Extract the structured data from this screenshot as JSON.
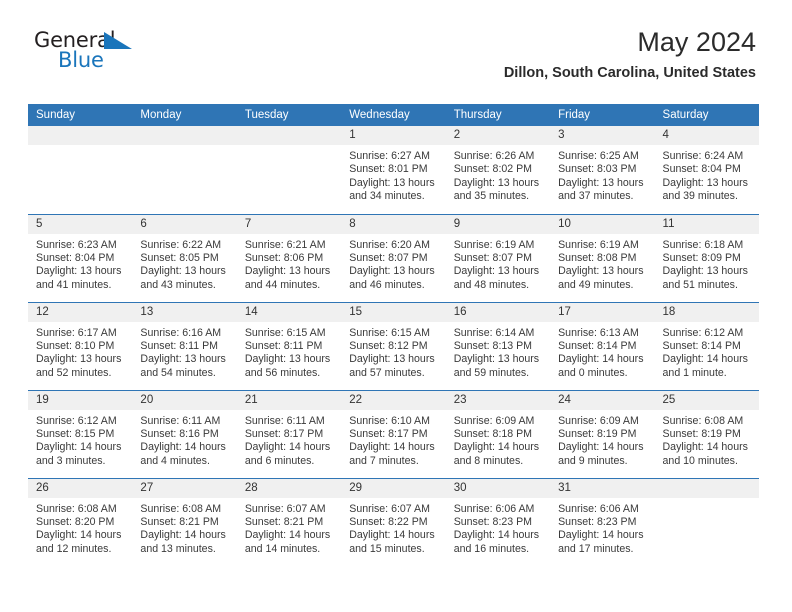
{
  "brand": {
    "name_part1": "General",
    "name_part2": "Blue"
  },
  "header": {
    "title": "May 2024",
    "subtitle": "Dillon, South Carolina, United States"
  },
  "colors": {
    "header_blue": "#2f75b5",
    "brand_blue": "#1a75bb",
    "daynum_bg": "#f0f0f0",
    "text": "#3a3a3a"
  },
  "weekday_headers": [
    "Sunday",
    "Monday",
    "Tuesday",
    "Wednesday",
    "Thursday",
    "Friday",
    "Saturday"
  ],
  "weeks": [
    [
      {
        "day": "",
        "sunrise": "",
        "sunset": "",
        "daylight_1": "",
        "daylight_2": ""
      },
      {
        "day": "",
        "sunrise": "",
        "sunset": "",
        "daylight_1": "",
        "daylight_2": ""
      },
      {
        "day": "",
        "sunrise": "",
        "sunset": "",
        "daylight_1": "",
        "daylight_2": ""
      },
      {
        "day": "1",
        "sunrise": "Sunrise: 6:27 AM",
        "sunset": "Sunset: 8:01 PM",
        "daylight_1": "Daylight: 13 hours",
        "daylight_2": "and 34 minutes."
      },
      {
        "day": "2",
        "sunrise": "Sunrise: 6:26 AM",
        "sunset": "Sunset: 8:02 PM",
        "daylight_1": "Daylight: 13 hours",
        "daylight_2": "and 35 minutes."
      },
      {
        "day": "3",
        "sunrise": "Sunrise: 6:25 AM",
        "sunset": "Sunset: 8:03 PM",
        "daylight_1": "Daylight: 13 hours",
        "daylight_2": "and 37 minutes."
      },
      {
        "day": "4",
        "sunrise": "Sunrise: 6:24 AM",
        "sunset": "Sunset: 8:04 PM",
        "daylight_1": "Daylight: 13 hours",
        "daylight_2": "and 39 minutes."
      }
    ],
    [
      {
        "day": "5",
        "sunrise": "Sunrise: 6:23 AM",
        "sunset": "Sunset: 8:04 PM",
        "daylight_1": "Daylight: 13 hours",
        "daylight_2": "and 41 minutes."
      },
      {
        "day": "6",
        "sunrise": "Sunrise: 6:22 AM",
        "sunset": "Sunset: 8:05 PM",
        "daylight_1": "Daylight: 13 hours",
        "daylight_2": "and 43 minutes."
      },
      {
        "day": "7",
        "sunrise": "Sunrise: 6:21 AM",
        "sunset": "Sunset: 8:06 PM",
        "daylight_1": "Daylight: 13 hours",
        "daylight_2": "and 44 minutes."
      },
      {
        "day": "8",
        "sunrise": "Sunrise: 6:20 AM",
        "sunset": "Sunset: 8:07 PM",
        "daylight_1": "Daylight: 13 hours",
        "daylight_2": "and 46 minutes."
      },
      {
        "day": "9",
        "sunrise": "Sunrise: 6:19 AM",
        "sunset": "Sunset: 8:07 PM",
        "daylight_1": "Daylight: 13 hours",
        "daylight_2": "and 48 minutes."
      },
      {
        "day": "10",
        "sunrise": "Sunrise: 6:19 AM",
        "sunset": "Sunset: 8:08 PM",
        "daylight_1": "Daylight: 13 hours",
        "daylight_2": "and 49 minutes."
      },
      {
        "day": "11",
        "sunrise": "Sunrise: 6:18 AM",
        "sunset": "Sunset: 8:09 PM",
        "daylight_1": "Daylight: 13 hours",
        "daylight_2": "and 51 minutes."
      }
    ],
    [
      {
        "day": "12",
        "sunrise": "Sunrise: 6:17 AM",
        "sunset": "Sunset: 8:10 PM",
        "daylight_1": "Daylight: 13 hours",
        "daylight_2": "and 52 minutes."
      },
      {
        "day": "13",
        "sunrise": "Sunrise: 6:16 AM",
        "sunset": "Sunset: 8:11 PM",
        "daylight_1": "Daylight: 13 hours",
        "daylight_2": "and 54 minutes."
      },
      {
        "day": "14",
        "sunrise": "Sunrise: 6:15 AM",
        "sunset": "Sunset: 8:11 PM",
        "daylight_1": "Daylight: 13 hours",
        "daylight_2": "and 56 minutes."
      },
      {
        "day": "15",
        "sunrise": "Sunrise: 6:15 AM",
        "sunset": "Sunset: 8:12 PM",
        "daylight_1": "Daylight: 13 hours",
        "daylight_2": "and 57 minutes."
      },
      {
        "day": "16",
        "sunrise": "Sunrise: 6:14 AM",
        "sunset": "Sunset: 8:13 PM",
        "daylight_1": "Daylight: 13 hours",
        "daylight_2": "and 59 minutes."
      },
      {
        "day": "17",
        "sunrise": "Sunrise: 6:13 AM",
        "sunset": "Sunset: 8:14 PM",
        "daylight_1": "Daylight: 14 hours",
        "daylight_2": "and 0 minutes."
      },
      {
        "day": "18",
        "sunrise": "Sunrise: 6:12 AM",
        "sunset": "Sunset: 8:14 PM",
        "daylight_1": "Daylight: 14 hours",
        "daylight_2": "and 1 minute."
      }
    ],
    [
      {
        "day": "19",
        "sunrise": "Sunrise: 6:12 AM",
        "sunset": "Sunset: 8:15 PM",
        "daylight_1": "Daylight: 14 hours",
        "daylight_2": "and 3 minutes."
      },
      {
        "day": "20",
        "sunrise": "Sunrise: 6:11 AM",
        "sunset": "Sunset: 8:16 PM",
        "daylight_1": "Daylight: 14 hours",
        "daylight_2": "and 4 minutes."
      },
      {
        "day": "21",
        "sunrise": "Sunrise: 6:11 AM",
        "sunset": "Sunset: 8:17 PM",
        "daylight_1": "Daylight: 14 hours",
        "daylight_2": "and 6 minutes."
      },
      {
        "day": "22",
        "sunrise": "Sunrise: 6:10 AM",
        "sunset": "Sunset: 8:17 PM",
        "daylight_1": "Daylight: 14 hours",
        "daylight_2": "and 7 minutes."
      },
      {
        "day": "23",
        "sunrise": "Sunrise: 6:09 AM",
        "sunset": "Sunset: 8:18 PM",
        "daylight_1": "Daylight: 14 hours",
        "daylight_2": "and 8 minutes."
      },
      {
        "day": "24",
        "sunrise": "Sunrise: 6:09 AM",
        "sunset": "Sunset: 8:19 PM",
        "daylight_1": "Daylight: 14 hours",
        "daylight_2": "and 9 minutes."
      },
      {
        "day": "25",
        "sunrise": "Sunrise: 6:08 AM",
        "sunset": "Sunset: 8:19 PM",
        "daylight_1": "Daylight: 14 hours",
        "daylight_2": "and 10 minutes."
      }
    ],
    [
      {
        "day": "26",
        "sunrise": "Sunrise: 6:08 AM",
        "sunset": "Sunset: 8:20 PM",
        "daylight_1": "Daylight: 14 hours",
        "daylight_2": "and 12 minutes."
      },
      {
        "day": "27",
        "sunrise": "Sunrise: 6:08 AM",
        "sunset": "Sunset: 8:21 PM",
        "daylight_1": "Daylight: 14 hours",
        "daylight_2": "and 13 minutes."
      },
      {
        "day": "28",
        "sunrise": "Sunrise: 6:07 AM",
        "sunset": "Sunset: 8:21 PM",
        "daylight_1": "Daylight: 14 hours",
        "daylight_2": "and 14 minutes."
      },
      {
        "day": "29",
        "sunrise": "Sunrise: 6:07 AM",
        "sunset": "Sunset: 8:22 PM",
        "daylight_1": "Daylight: 14 hours",
        "daylight_2": "and 15 minutes."
      },
      {
        "day": "30",
        "sunrise": "Sunrise: 6:06 AM",
        "sunset": "Sunset: 8:23 PM",
        "daylight_1": "Daylight: 14 hours",
        "daylight_2": "and 16 minutes."
      },
      {
        "day": "31",
        "sunrise": "Sunrise: 6:06 AM",
        "sunset": "Sunset: 8:23 PM",
        "daylight_1": "Daylight: 14 hours",
        "daylight_2": "and 17 minutes."
      },
      {
        "day": "",
        "sunrise": "",
        "sunset": "",
        "daylight_1": "",
        "daylight_2": ""
      }
    ]
  ]
}
